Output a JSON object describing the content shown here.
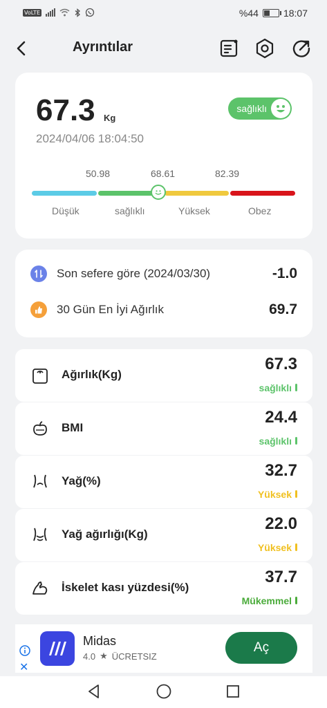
{
  "status_bar": {
    "volte": "VoLTE",
    "battery": "%44",
    "time": "18:07",
    "battery_level": 0.44
  },
  "header": {
    "title": "Ayrıntılar",
    "icons": [
      "back-icon",
      "report-icon",
      "settings-icon",
      "share-icon"
    ]
  },
  "summary": {
    "weight": "67.3",
    "unit": "Kg",
    "badge": "sağlıklı",
    "datetime": "2024/04/06 18:04:50",
    "thresholds": [
      "50.98",
      "68.61",
      "82.39"
    ],
    "scale_labels": [
      "Düşük",
      "sağlıklı",
      "Yüksek",
      "Obez"
    ],
    "scale_colors": [
      "#5ccbe6",
      "#5cc36a",
      "#f0c93e",
      "#d9141b"
    ]
  },
  "compare": [
    {
      "label": "Son sefere göre (2024/03/30)",
      "value": "-1.0",
      "icon": "swap-icon",
      "color": "#6b82e8"
    },
    {
      "label": "30 Gün En İyi Ağırlık",
      "value": "69.7",
      "icon": "thumbs-up-icon",
      "color": "#f5a03a"
    }
  ],
  "metrics": [
    {
      "name": "Ağırlık(Kg)",
      "value": "67.3",
      "status": "sağlıklı",
      "color": "#5cc36a",
      "icon": "scale-icon"
    },
    {
      "name": "BMI",
      "value": "24.4",
      "status": "sağlıklı",
      "color": "#5cc36a",
      "icon": "bmi-icon"
    },
    {
      "name": "Yağ(%)",
      "value": "32.7",
      "status": "Yüksek",
      "color": "#f0c020",
      "icon": "body-fat-icon"
    },
    {
      "name": "Yağ ağırlığı(Kg)",
      "value": "22.0",
      "status": "Yüksek",
      "color": "#f0c020",
      "icon": "fat-weight-icon"
    },
    {
      "name": "İskelet kası yüzdesi(%)",
      "value": "37.7",
      "status": "Mükemmel",
      "color": "#4aab3a",
      "icon": "muscle-icon"
    }
  ],
  "ad": {
    "app_name": "Midas",
    "rating": "4.0",
    "price": "ÜCRETSIZ",
    "button": "Aç"
  }
}
